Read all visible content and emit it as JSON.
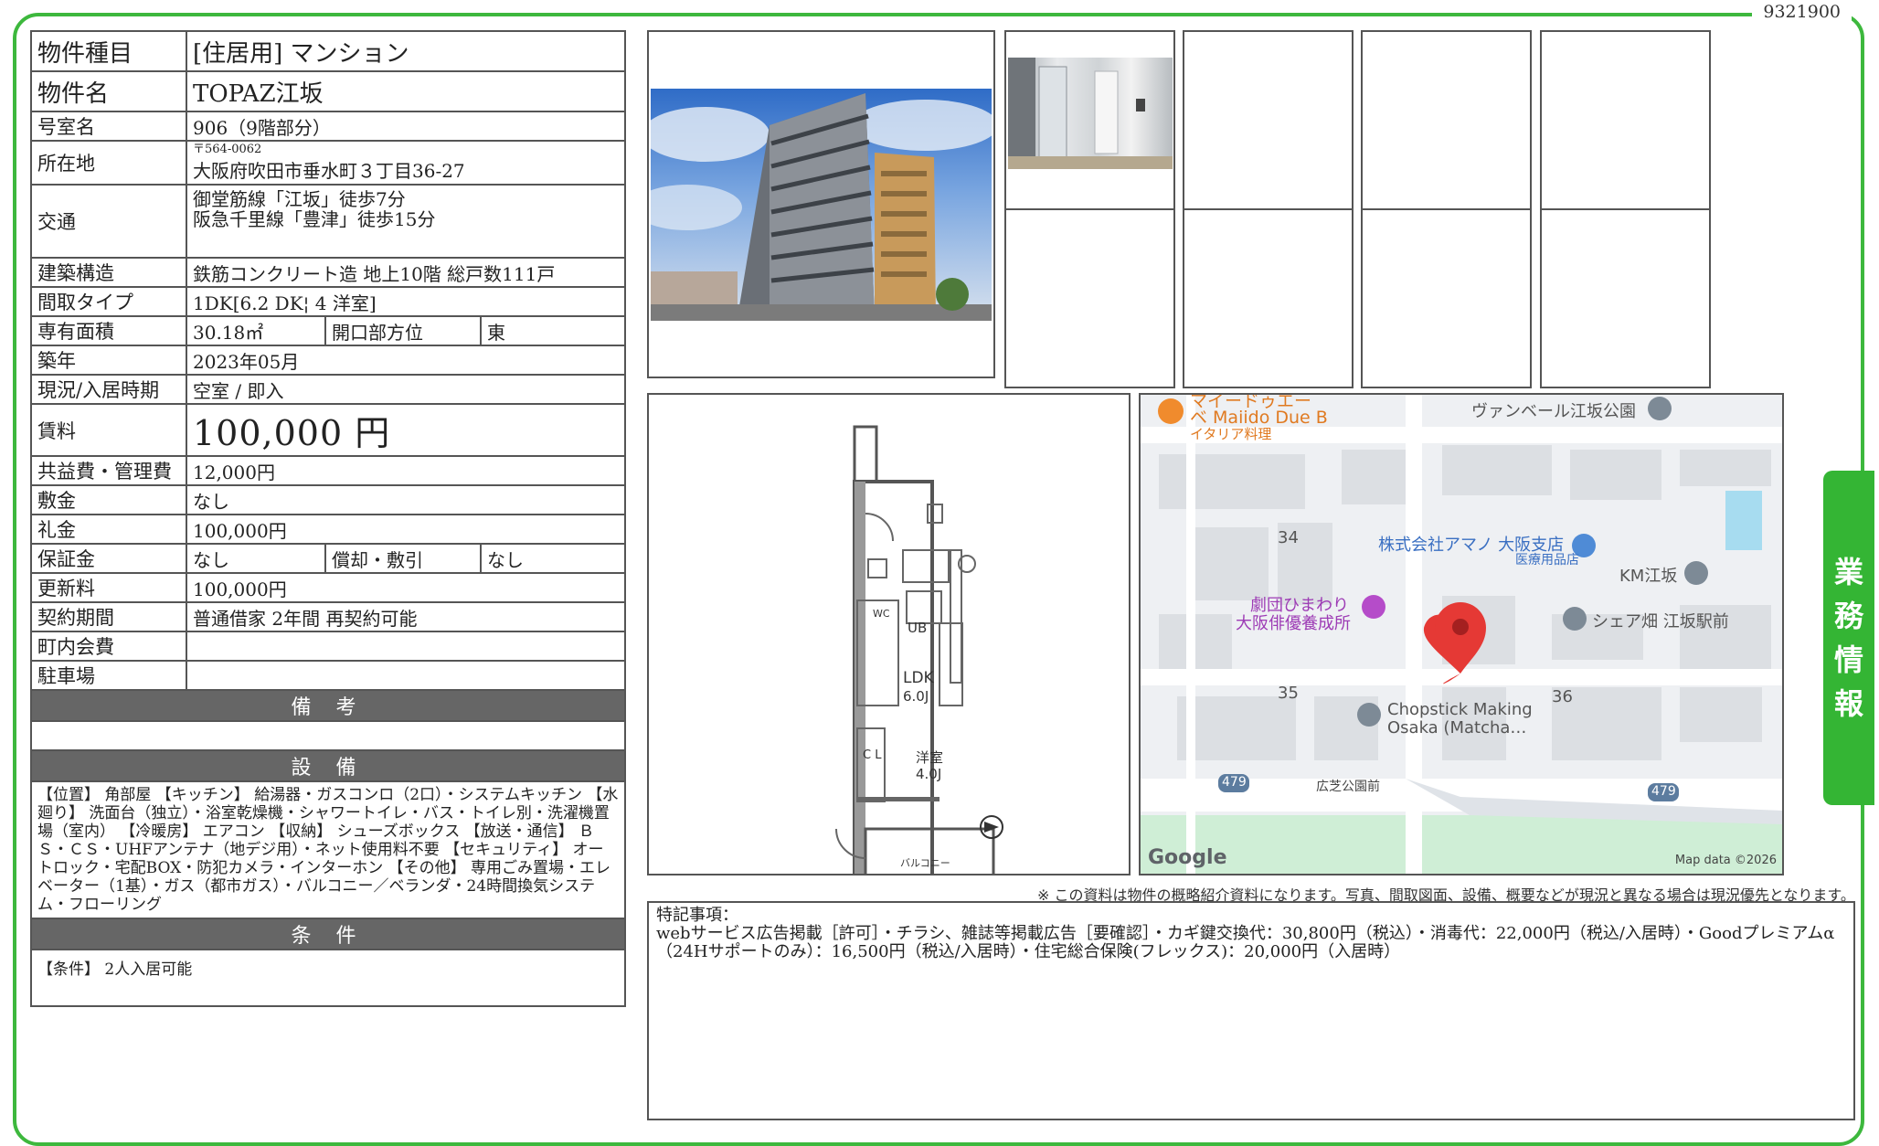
{
  "doc_id": "9321900",
  "side_tab": [
    "業",
    "務",
    "情",
    "報"
  ],
  "spec": {
    "type_label": "物件種目",
    "type_value": "[住居用] マンション",
    "name_label": "物件名",
    "name_value": "TOPAZ江坂",
    "room_label": "号室名",
    "room_value": "906（9階部分）",
    "address_label": "所在地",
    "postal": "〒564-0062",
    "address_value": "大阪府吹田市垂水町３丁目36-27",
    "traffic_label": "交通",
    "traffic_line1": "御堂筋線「江坂」徒歩7分",
    "traffic_line2": "阪急千里線「豊津」徒歩15分",
    "structure_label": "建築構造",
    "structure_value": "鉄筋コンクリート造 地上10階 総戸数111戸",
    "layout_label": "間取タイプ",
    "layout_value": "1DK[6.2 DK¦ 4 洋室]",
    "area_label": "専有面積",
    "area_value": "30.18㎡",
    "facing_label": "開口部方位",
    "facing_value": "東",
    "built_label": "築年",
    "built_value": "2023年05月",
    "status_label": "現況/入居時期",
    "status_value": "空室 / 即入",
    "rent_label": "賃料",
    "rent_value": "100,000 円",
    "fee_label": "共益費・管理費",
    "fee_value": "12,000円",
    "deposit_label": "敷金",
    "deposit_value": "なし",
    "key_money_label": "礼金",
    "key_money_value": "100,000円",
    "guarantee_label": "保証金",
    "guarantee_value": "なし",
    "amort_label": "償却・敷引",
    "amort_value": "なし",
    "renewal_label": "更新料",
    "renewal_value": "100,000円",
    "contract_label": "契約期間",
    "contract_value": "普通借家 2年間 再契約可能",
    "town_fee_label": "町内会費",
    "town_fee_value": "",
    "parking_label": "駐車場",
    "parking_value": "",
    "remarks_header": "備 考",
    "remarks_value": "",
    "equipment_header": "設 備",
    "equipment_text": "【位置】 角部屋 【キッチン】 給湯器・ガスコンロ（2口）・システムキッチン 【水廻り】 洗面台（独立）・浴室乾燥機・シャワートイレ・バス・トイレ別・洗濯機置場（室内） 【冷暖房】 エアコン 【収納】 シューズボックス 【放送・通信】 ＢＳ・ＣＳ・UHFアンテナ（地デジ用）・ネット使用料不要 【セキュリティ】 オートロック・宅配BOX・防犯カメラ・インターホン 【その他】 専用ごみ置場・エレベーター（1基）・ガス（都市ガス）・バルコニー／ベランダ・24時間換気システム・フローリング",
    "conditions_header": "条 件",
    "conditions_text": "【条件】 2人入居可能"
  },
  "floorplan": {
    "ldk": "LDK",
    "ldk_size": "6.0J",
    "room": "洋室",
    "room_size": "4.0J",
    "ub": "UB",
    "wc": "WC",
    "cl": "C\nL",
    "balcony": "バルコニー"
  },
  "map": {
    "labels": {
      "restaurant_top": "マイードゥエー",
      "restaurant": "ベ Maiido Due B",
      "restaurant_sub": "イタリア料理",
      "park": "ヴァンベール江坂公園",
      "company": "株式会社アマノ 大阪支店",
      "company_sub": "医療用品店",
      "km": "KM江坂",
      "theater1": "劇団ひまわり",
      "theater2": "大阪俳優養成所",
      "share": "シェア畑 江坂駅前",
      "chopstick1": "Chopstick Making",
      "chopstick2": "Osaka (Matcha…",
      "block34": "34",
      "block35": "35",
      "block36": "36",
      "road1": "479",
      "road2": "479",
      "bus": "広芝公園前",
      "google": "Google",
      "mapdata": "Map data ©2026"
    }
  },
  "disclaimer": "※ この資料は物件の概略紹介資料になります。写真、間取図面、設備、概要などが現況と異なる場合は現況優先となります。",
  "remarks": {
    "title": "特記事項：",
    "text": "webサービス広告掲載［許可］・チラシ、雑誌等掲載広告［要確認］・カギ鍵交換代：30,800円（税込）・消毒代：22,000円（税込/入居時）・Goodプレミアムα （24Hサポートのみ）：16,500円（税込/入居時）・住宅総合保険(フレックス)：20,000円（入居時）"
  },
  "colors": {
    "frame": "#3db83d",
    "side_tab": "#34b534",
    "header_bar": "#666666",
    "pin": "#e53935"
  }
}
